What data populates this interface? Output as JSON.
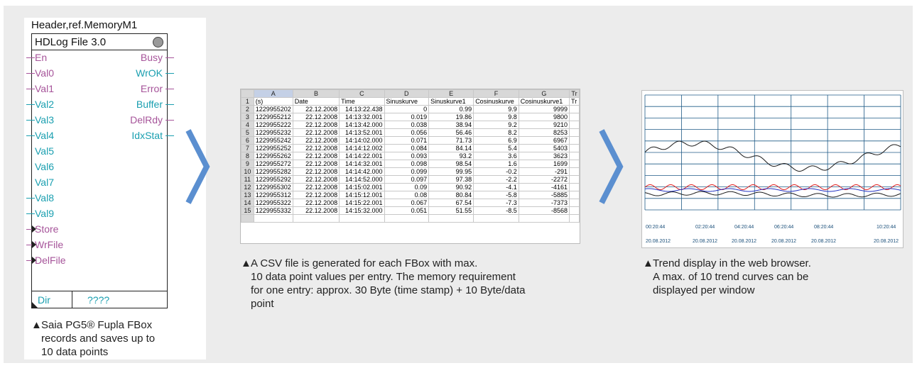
{
  "fbox": {
    "header": "Header,ref.MemoryM1",
    "title": "HDLog File 3.0",
    "pins_left": [
      {
        "label": "En",
        "color": "magenta",
        "stub": true,
        "trigger": false
      },
      {
        "label": "Val0",
        "color": "magenta",
        "stub": true,
        "trigger": false
      },
      {
        "label": "Val1",
        "color": "magenta",
        "stub": true,
        "trigger": false
      },
      {
        "label": "Val2",
        "color": "cyan",
        "stub": true,
        "trigger": false
      },
      {
        "label": "Val3",
        "color": "cyan",
        "stub": true,
        "trigger": false
      },
      {
        "label": "Val4",
        "color": "cyan",
        "stub": true,
        "trigger": false
      },
      {
        "label": "Val5",
        "color": "cyan",
        "stub": false,
        "trigger": false
      },
      {
        "label": "Val6",
        "color": "cyan",
        "stub": false,
        "trigger": false
      },
      {
        "label": "Val7",
        "color": "cyan",
        "stub": false,
        "trigger": false
      },
      {
        "label": "Val8",
        "color": "cyan",
        "stub": true,
        "trigger": false
      },
      {
        "label": "Val9",
        "color": "cyan",
        "stub": true,
        "trigger": false
      },
      {
        "label": "Store",
        "color": "magenta",
        "stub": true,
        "trigger": true
      },
      {
        "label": "WrFile",
        "color": "magenta",
        "stub": true,
        "trigger": true
      },
      {
        "label": "DelFile",
        "color": "magenta",
        "stub": true,
        "trigger": true
      }
    ],
    "pins_right": [
      {
        "label": "Busy",
        "color": "magenta"
      },
      {
        "label": "WrOK",
        "color": "cyan"
      },
      {
        "label": "Error",
        "color": "magenta"
      },
      {
        "label": "Buffer",
        "color": "cyan"
      },
      {
        "label": "DelRdy",
        "color": "magenta"
      },
      {
        "label": "IdxStat",
        "color": "cyan"
      }
    ],
    "dir_label": "Dir",
    "dir_value": "????",
    "caption_lines": [
      "Saia PG5® Fupla FBox",
      "records and saves up to",
      "10 data points"
    ]
  },
  "sheet": {
    "columns": [
      "A",
      "B",
      "C",
      "D",
      "E",
      "F",
      "G",
      "Tr"
    ],
    "rows": [
      [
        "1",
        "(s)",
        "Date",
        "Time",
        "Sinuskurve",
        "Sinuskurve1",
        "Cosinuskurve",
        "Cosinuskurve1",
        "Tr"
      ],
      [
        "2",
        "1229955202",
        "22.12.2008",
        "14:13:22.438",
        "0",
        "0.99",
        "9.9",
        "9999",
        ""
      ],
      [
        "3",
        "1229955212",
        "22.12.2008",
        "14:13:32.001",
        "0.019",
        "19.86",
        "9.8",
        "9800",
        ""
      ],
      [
        "4",
        "1229955222",
        "22.12.2008",
        "14:13:42.000",
        "0.038",
        "38.94",
        "9.2",
        "9210",
        ""
      ],
      [
        "5",
        "1229955232",
        "22.12.2008",
        "14:13:52.001",
        "0.056",
        "56.46",
        "8.2",
        "8253",
        ""
      ],
      [
        "6",
        "1229955242",
        "22.12.2008",
        "14:14:02.000",
        "0.071",
        "71.73",
        "6.9",
        "6967",
        ""
      ],
      [
        "7",
        "1229955252",
        "22.12.2008",
        "14:14:12.002",
        "0.084",
        "84.14",
        "5.4",
        "5403",
        ""
      ],
      [
        "8",
        "1229955262",
        "22.12.2008",
        "14:14:22.001",
        "0.093",
        "93.2",
        "3.6",
        "3623",
        ""
      ],
      [
        "9",
        "1229955272",
        "22.12.2008",
        "14:14:32.001",
        "0.098",
        "98.54",
        "1.6",
        "1699",
        ""
      ],
      [
        "10",
        "1229955282",
        "22.12.2008",
        "14:14:42.000",
        "0.099",
        "99.95",
        "-0.2",
        "-291",
        ""
      ],
      [
        "11",
        "1229955292",
        "22.12.2008",
        "14:14:52.000",
        "0.097",
        "97.38",
        "-2.2",
        "-2272",
        ""
      ],
      [
        "12",
        "1229955302",
        "22.12.2008",
        "14:15:02.001",
        "0.09",
        "90.92",
        "-4.1",
        "-4161",
        ""
      ],
      [
        "13",
        "1229955312",
        "22.12.2008",
        "14:15:12.001",
        "0.08",
        "80.84",
        "-5.8",
        "-5885",
        ""
      ],
      [
        "14",
        "1229955322",
        "22.12.2008",
        "14:15:22.001",
        "0.067",
        "67.54",
        "-7.3",
        "-7373",
        ""
      ],
      [
        "15",
        "1229955332",
        "22.12.2008",
        "14:15:32.000",
        "0.051",
        "51.55",
        "-8.5",
        "-8568",
        ""
      ]
    ],
    "caption_lines": [
      "A CSV file is generated for each FBox with max.",
      "10 data point values per entry. The memory requirement",
      "for one entry: approx. 30 Byte (time stamp) + 10 Byte/data",
      "point"
    ]
  },
  "trend": {
    "time_labels": [
      "00:20:44",
      "02:20:44",
      "04:20:44",
      "06:20:44",
      "08:20:44",
      "10:20:44"
    ],
    "date_labels": [
      "20.08.2012",
      "20.08.2012",
      "20.08.2012",
      "20.08.2012",
      "20.08.2012",
      "20.08.2012"
    ],
    "caption_lines": [
      "Trend display in the web browser.",
      "A max. of 10 trend curves can be",
      "displayed per window"
    ]
  },
  "colors": {
    "background": "#ececec",
    "pin_magenta": "#a6549a",
    "pin_cyan": "#1a9fb0",
    "arrow": "#5b8fd0",
    "grid": "#1f5a86"
  },
  "icons": {
    "caption_marker": "black-up-triangle",
    "flow_arrow": "chevron-right-icon"
  }
}
